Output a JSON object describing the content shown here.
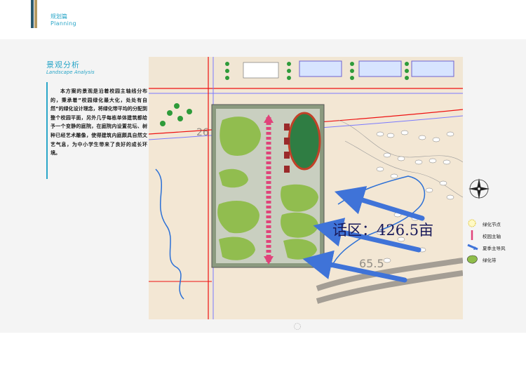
{
  "header": {
    "section_cn": "规划篇",
    "section_en": "Planning"
  },
  "panel": {
    "title_cn": "景观分析",
    "title_en": "Landscape Analysis",
    "body": "本方案的景观是沿着校园主轴线分布的，秉承着”校园绿化最大化，处处有自然”的绿化设计理念，将绿化带平均的分配到整个校园平面，另外几乎每栋单体建筑都给予一个变静的庭院，在庭院内设置花坛、树种已经艺术雕像，使得建筑内庭颇具自然文艺气息，为中小学生带来了良好的成长环境。"
  },
  "map": {
    "area_label": "话区：426.5亩",
    "road_code_1": "26",
    "road_code_2": "65.5"
  },
  "legend": {
    "items": [
      {
        "icon": "green-node-icon",
        "label": "绿化节点"
      },
      {
        "icon": "campus-axis-icon",
        "label": "校园主轴"
      },
      {
        "icon": "summer-wind-arrow-icon",
        "label": "夏季主导风"
      },
      {
        "icon": "green-belt-icon",
        "label": "绿化带"
      }
    ]
  },
  "colors": {
    "accent": "#2aa6c8",
    "axis": "#e0437a",
    "wind": "#3f73d8",
    "green": "#8fbd4a"
  }
}
